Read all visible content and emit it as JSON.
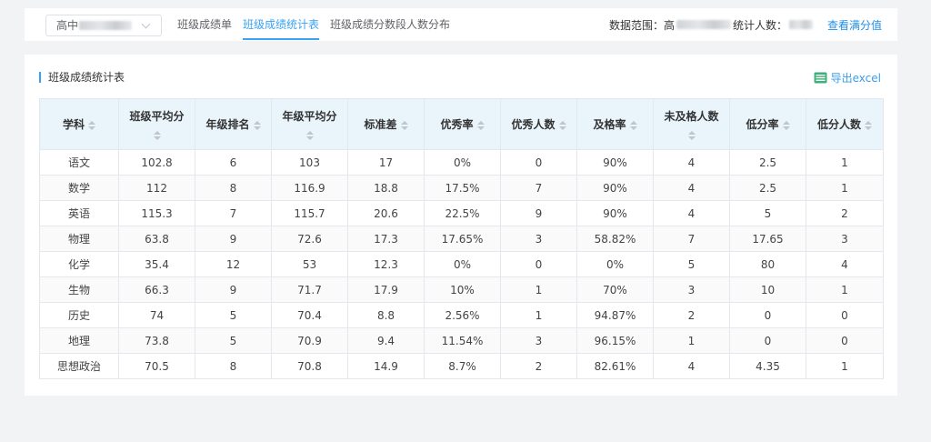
{
  "top_bar": {
    "school_select": {
      "value": "高中"
    },
    "tabs": [
      {
        "label": "班级成绩单",
        "active": false
      },
      {
        "label": "班级成绩统计表",
        "active": true
      },
      {
        "label": "班级成绩分数段人数分布",
        "active": false
      }
    ],
    "data_range_label": "数据范围：高",
    "student_count_label": "统计人数：",
    "view_full_score_link": "查看满分值"
  },
  "panel": {
    "title": "班级成绩统计表",
    "export_label": "导出excel"
  },
  "table": {
    "columns": [
      {
        "label": "学科",
        "sortable": true
      },
      {
        "label": "班级平均分",
        "sortable": true
      },
      {
        "label": "年级排名",
        "sortable": true
      },
      {
        "label": "年级平均分",
        "sortable": true
      },
      {
        "label": "标准差",
        "sortable": true
      },
      {
        "label": "优秀率",
        "sortable": true
      },
      {
        "label": "优秀人数",
        "sortable": true
      },
      {
        "label": "及格率",
        "sortable": true
      },
      {
        "label": "未及格人数",
        "sortable": true
      },
      {
        "label": "低分率",
        "sortable": true
      },
      {
        "label": "低分人数",
        "sortable": true
      }
    ],
    "rows": [
      [
        "语文",
        "102.8",
        "6",
        "103",
        "17",
        "0%",
        "0",
        "90%",
        "4",
        "2.5",
        "1"
      ],
      [
        "数学",
        "112",
        "8",
        "116.9",
        "18.8",
        "17.5%",
        "7",
        "90%",
        "4",
        "2.5",
        "1"
      ],
      [
        "英语",
        "115.3",
        "7",
        "115.7",
        "20.6",
        "22.5%",
        "9",
        "90%",
        "4",
        "5",
        "2"
      ],
      [
        "物理",
        "63.8",
        "9",
        "72.6",
        "17.3",
        "17.65%",
        "3",
        "58.82%",
        "7",
        "17.65",
        "3"
      ],
      [
        "化学",
        "35.4",
        "12",
        "53",
        "12.3",
        "0%",
        "0",
        "0%",
        "5",
        "80",
        "4"
      ],
      [
        "生物",
        "66.3",
        "9",
        "71.7",
        "17.9",
        "10%",
        "1",
        "70%",
        "3",
        "10",
        "1"
      ],
      [
        "历史",
        "74",
        "5",
        "70.4",
        "8.8",
        "2.56%",
        "1",
        "94.87%",
        "2",
        "0",
        "0"
      ],
      [
        "地理",
        "73.8",
        "5",
        "70.9",
        "9.4",
        "11.54%",
        "3",
        "96.15%",
        "1",
        "0",
        "0"
      ],
      [
        "思想政治",
        "70.5",
        "8",
        "70.8",
        "14.9",
        "8.7%",
        "2",
        "82.61%",
        "4",
        "4.35",
        "1"
      ]
    ]
  },
  "icons": {
    "select": "chevron-down-icon",
    "export": "excel-icon",
    "sort": "sort-icon"
  },
  "colors": {
    "accent": "#39a2f2",
    "header_bg": "#e9f5fb",
    "excel": "#3fb07a",
    "page_bg": "#f2f3f5"
  }
}
